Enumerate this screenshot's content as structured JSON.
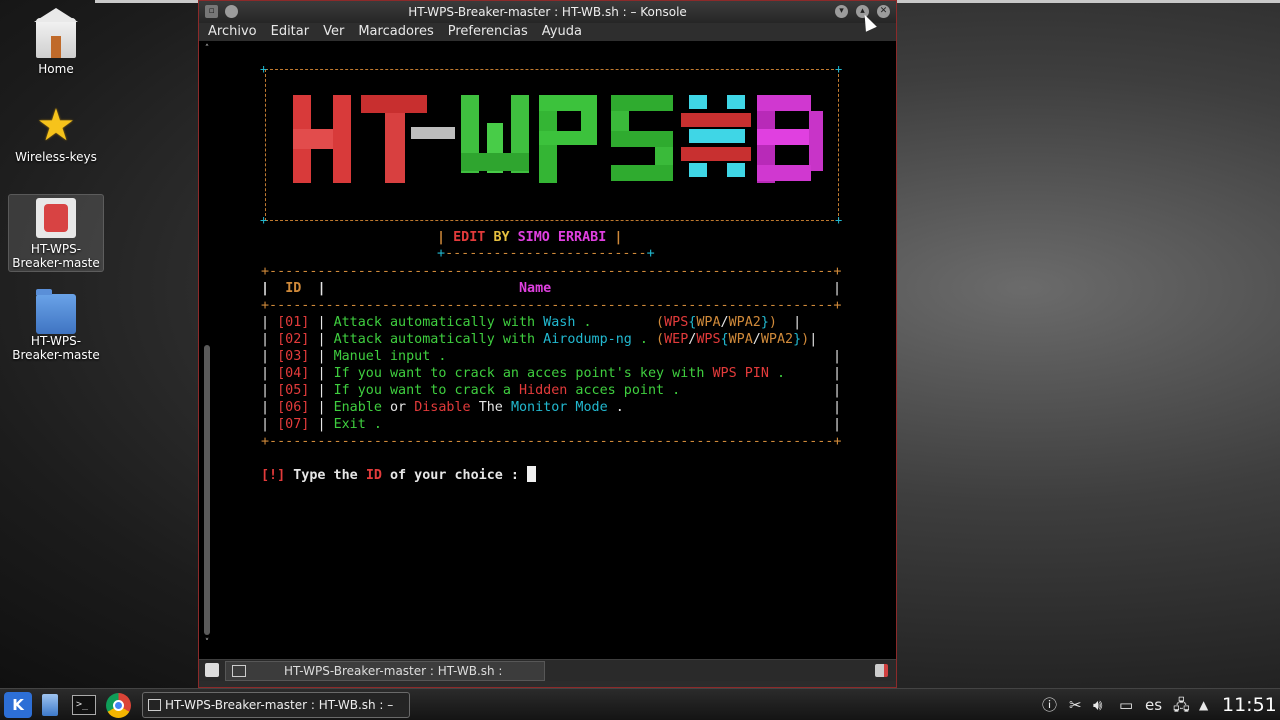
{
  "window": {
    "title": "HT-WPS-Breaker-master : HT-WB.sh : – Konsole",
    "menu": [
      "Archivo",
      "Editar",
      "Ver",
      "Marcadores",
      "Preferencias",
      "Ayuda"
    ],
    "tab_label": "HT-WPS-Breaker-master : HT-WB.sh :"
  },
  "desktop_icons": [
    {
      "label": "Home",
      "icon": "home-folder-icon"
    },
    {
      "label": "Wireless-keys",
      "icon": "star-icon"
    },
    {
      "label": "HT-WPS-Breaker-master",
      "icon": "app-icon"
    },
    {
      "label": "HT-WPS-Breaker-master",
      "icon": "folder-icon"
    }
  ],
  "terminal": {
    "edit_by": {
      "pipe_l": "|",
      "edit": "EDIT",
      "by": "BY",
      "name": "SIMO ERRABI",
      "pipe_r": "|"
    },
    "table_header": {
      "id": "ID",
      "name": "Name"
    },
    "options": [
      {
        "id": "[01]",
        "text": "Attack automatically with",
        "hl": "Wash",
        "tail": " .",
        "extra": "(WPS{WPA/WPA2})"
      },
      {
        "id": "[02]",
        "text": "Attack automatically with",
        "hl": "Airodump-ng",
        "tail": " .",
        "extra": "(WEP/WPS{WPA/WPA2})"
      },
      {
        "id": "[03]",
        "text": "Manuel input .",
        "hl": "",
        "tail": "",
        "extra": ""
      },
      {
        "id": "[04]",
        "text": "If you want to crack an acces point's key with",
        "hl": "WPS PIN",
        "tail": " .",
        "extra": ""
      },
      {
        "id": "[05]",
        "text": "If you want to crack a",
        "hl": "Hidden",
        "tail": " acces point .",
        "extra": ""
      },
      {
        "id": "[06]",
        "text": "Enable",
        "hl": "Disable",
        "tail": " Mode .",
        "extra": ""
      },
      {
        "id": "[07]",
        "text": "Exit .",
        "hl": "",
        "tail": "",
        "extra": ""
      }
    ],
    "opt6": {
      "enable": "Enable",
      "or": "or",
      "disable": "Disable",
      "the": "The",
      "monitor": "Monitor Mode",
      "dot": "."
    },
    "prompt": {
      "mark": "[!]",
      "pre": "Type the",
      "id": "ID",
      "post": "of your choice :"
    }
  },
  "taskbar": {
    "task_label": "HT-WPS-Breaker-master : HT-WB.sh : – ",
    "lang": "es",
    "clock": "11:51",
    "icons": [
      "kde-menu-icon",
      "file-manager-icon",
      "terminal-icon",
      "chrome-icon"
    ],
    "tray_icons": [
      "info-icon",
      "clipboard-icon",
      "volume-icon",
      "display-icon",
      "network-icon",
      "tray-expand-icon"
    ]
  },
  "colors": {
    "accent_border": "#8c2a2a",
    "terminal_bg": "#000000"
  }
}
